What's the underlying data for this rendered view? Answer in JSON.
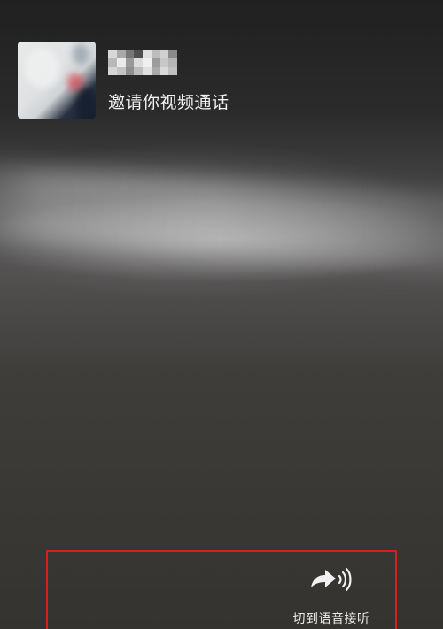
{
  "caller": {
    "avatar_icon": "contact-avatar-icon",
    "name_display": "",
    "invite_text": "邀请你视频通话"
  },
  "actions": {
    "switch_to_audio_label": "切到语音接听",
    "switch_to_audio_icon": "forward-arrow-speaker-icon"
  },
  "colors": {
    "highlight_border": "#d81e1e",
    "text_primary": "#f2f2f2"
  }
}
